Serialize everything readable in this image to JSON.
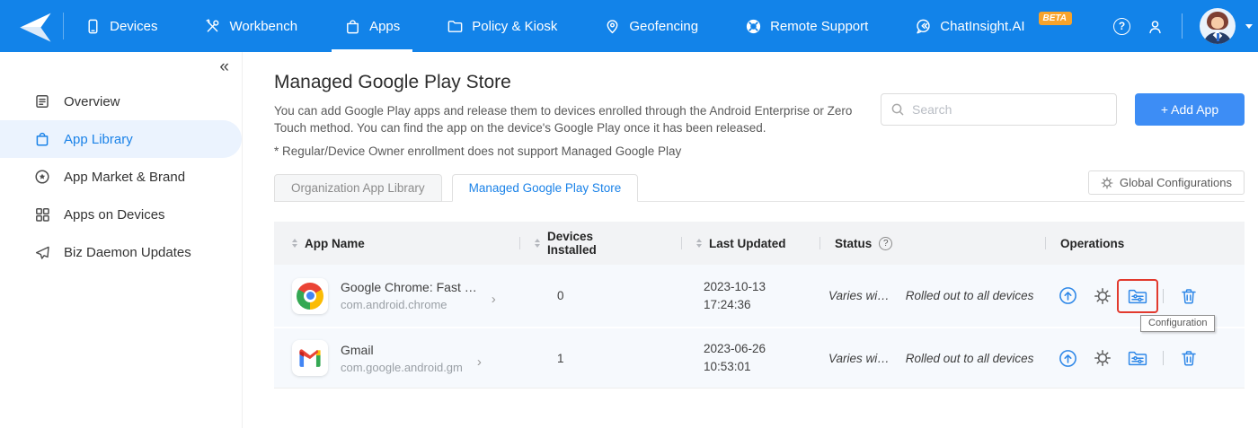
{
  "nav": {
    "items": [
      {
        "label": "Devices",
        "icon": "devices-icon",
        "active": false
      },
      {
        "label": "Workbench",
        "icon": "workbench-icon",
        "active": false
      },
      {
        "label": "Apps",
        "icon": "apps-icon",
        "active": true
      },
      {
        "label": "Policy & Kiosk",
        "icon": "policy-kiosk-icon",
        "active": false
      },
      {
        "label": "Geofencing",
        "icon": "geofencing-icon",
        "active": false
      },
      {
        "label": "Remote Support",
        "icon": "remote-support-icon",
        "active": false
      },
      {
        "label": "ChatInsight.AI",
        "icon": "chatinsight-icon",
        "active": false,
        "badge": "BETA"
      }
    ]
  },
  "sidebar": {
    "collapse_glyph": "«",
    "items": [
      {
        "label": "Overview",
        "icon": "overview-icon",
        "active": false
      },
      {
        "label": "App Library",
        "icon": "app-library-icon",
        "active": true
      },
      {
        "label": "App Market & Brand",
        "icon": "app-market-icon",
        "active": false
      },
      {
        "label": "Apps on Devices",
        "icon": "apps-on-devices-icon",
        "active": false
      },
      {
        "label": "Biz Daemon Updates",
        "icon": "biz-daemon-icon",
        "active": false
      }
    ]
  },
  "page": {
    "title": "Managed Google Play Store",
    "description": "You can add Google Play apps and release them to devices enrolled through the Android Enterprise or Zero Touch method. You can find the app on the device's Google Play once it has been released.",
    "note": "* Regular/Device Owner enrollment does not support Managed Google Play",
    "search": {
      "placeholder": "Search"
    },
    "add_app_label": "+ Add App",
    "tabs": [
      {
        "label": "Organization App Library",
        "active": false
      },
      {
        "label": "Managed Google Play Store",
        "active": true
      }
    ],
    "global_config_label": "Global Configurations",
    "help_glyph": "?",
    "status_help_glyph": "?"
  },
  "table": {
    "headers": {
      "app_name": "App Name",
      "devices_installed": "Devices Installed",
      "last_updated": "Last Updated",
      "status": "Status",
      "operations": "Operations"
    },
    "rows": [
      {
        "app_name": "Google Chrome: Fast …",
        "package": "com.android.chrome",
        "devices_installed": "0",
        "updated_date": "2023-10-13",
        "updated_time": "17:24:36",
        "status_version": "Varies wi…",
        "status_rollout": "Rolled out to all devices"
      },
      {
        "app_name": "Gmail",
        "package": "com.google.android.gm",
        "devices_installed": "1",
        "updated_date": "2023-06-26",
        "updated_time": "10:53:01",
        "status_version": "Varies wi…",
        "status_rollout": "Rolled out to all devices"
      }
    ],
    "tooltip": "Configuration"
  },
  "colors": {
    "nav_blue": "#1283E9",
    "accent_blue": "#1A82E8",
    "add_app_blue": "#3D8DF5",
    "beta_badge_orange": "#F7A32B",
    "highlight_red": "#E23A2E",
    "selected_sidebar_bg": "#EBF3FE",
    "row_bg": "#F6F9FD",
    "header_bg": "#F2F3F5"
  }
}
